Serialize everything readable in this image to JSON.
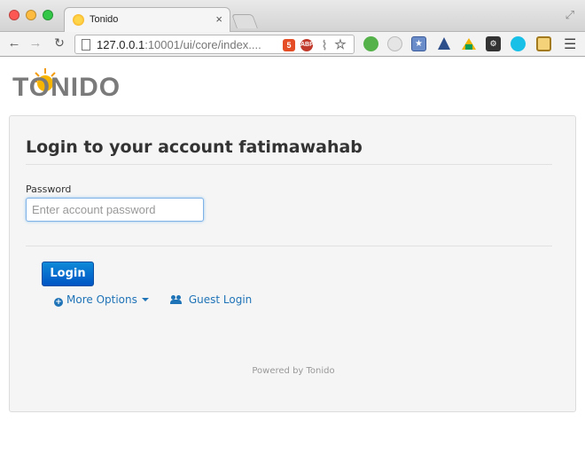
{
  "browser": {
    "tab_title": "Tonido",
    "url_host": "127.0.0.1",
    "url_rest": ":10001/ui/core/index....",
    "omnibox_icons": [
      "html5-icon",
      "adblock-icon",
      "paperclip-icon",
      "star-icon"
    ],
    "extension_icons": [
      "green-ball-icon",
      "magnifier-icon",
      "bookmark-star-icon",
      "mountain-icon",
      "drive-icon",
      "toolbox-icon",
      "chat-bubble-icon",
      "clipboard-icon"
    ]
  },
  "logo": {
    "text": "TONIDO"
  },
  "login": {
    "title": "Login to your account fatimawahab",
    "password_label": "Password",
    "password_placeholder": "Enter account password",
    "password_value": "",
    "login_button": "Login",
    "more_options": "More Options",
    "guest_login": "Guest Login",
    "powered_by": "Powered by Tonido"
  },
  "colors": {
    "accent": "#1f73b7",
    "button": "#0055c4",
    "panel_bg": "#f5f5f5"
  }
}
